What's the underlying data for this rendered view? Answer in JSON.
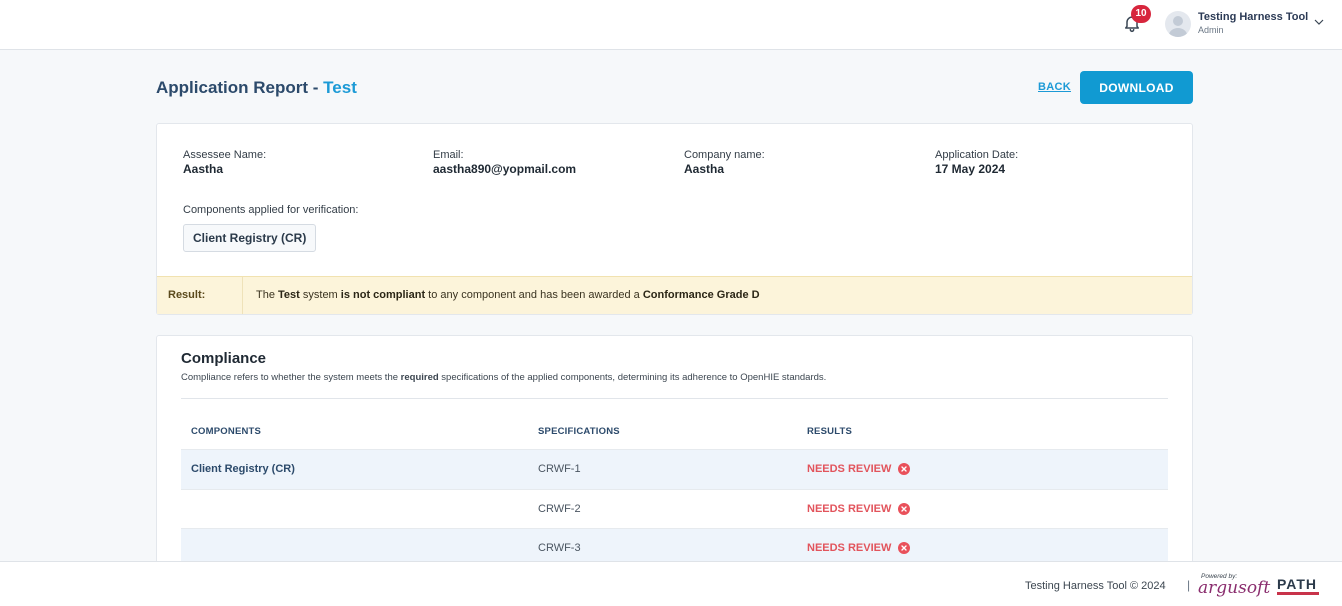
{
  "header": {
    "notification_count": "10",
    "user_name": "Testing Harness Tool",
    "user_role": "Admin"
  },
  "page": {
    "title_prefix": "Application Report - ",
    "title_name": "Test",
    "back_label": "BACK",
    "download_label": "DOWNLOAD"
  },
  "info": {
    "assessee_label": "Assessee Name:",
    "assessee_value": "Aastha",
    "email_label": "Email:",
    "email_value": "aastha890@yopmail.com",
    "company_label": "Company name:",
    "company_value": "Aastha",
    "date_label": "Application Date:",
    "date_value": "17 May 2024",
    "components_label": "Components applied for verification:",
    "component_chip": "Client Registry (CR)"
  },
  "result": {
    "label": "Result:",
    "part1": "The ",
    "system_name": "Test",
    "part2": " system ",
    "status": "is not compliant",
    "part3": " to any component and has been awarded a ",
    "grade": "Conformance Grade D"
  },
  "compliance": {
    "title": "Compliance",
    "desc_part1": "Compliance refers to whether the system meets the ",
    "desc_bold": "required",
    "desc_part2": " specifications of the applied components, determining its adherence to OpenHIE standards.",
    "col_components": "COMPONENTS",
    "col_specifications": "SPECIFICATIONS",
    "col_results": "RESULTS",
    "rows": [
      {
        "component": "Client Registry (CR)",
        "specification": "CRWF-1",
        "result": "NEEDS REVIEW"
      },
      {
        "component": "",
        "specification": "CRWF-2",
        "result": "NEEDS REVIEW"
      },
      {
        "component": "",
        "specification": "CRWF-3",
        "result": "NEEDS REVIEW"
      }
    ]
  },
  "footer": {
    "copyright": "Testing Harness Tool © 2024",
    "separator": "|",
    "powered_by": "Powered by:",
    "argusoft": "argusoft",
    "path": "PATH"
  },
  "icons": {
    "notification": "bell-icon",
    "avatar": "user-avatar-icon",
    "dropdown": "chevron-down-icon",
    "status": "x-circle-icon"
  },
  "colors": {
    "accent": "#1c9ad6",
    "download_button": "#119ad2",
    "badge": "#d7263d",
    "needs_review": "#e2545c",
    "result_bar": "#fcf4da"
  }
}
